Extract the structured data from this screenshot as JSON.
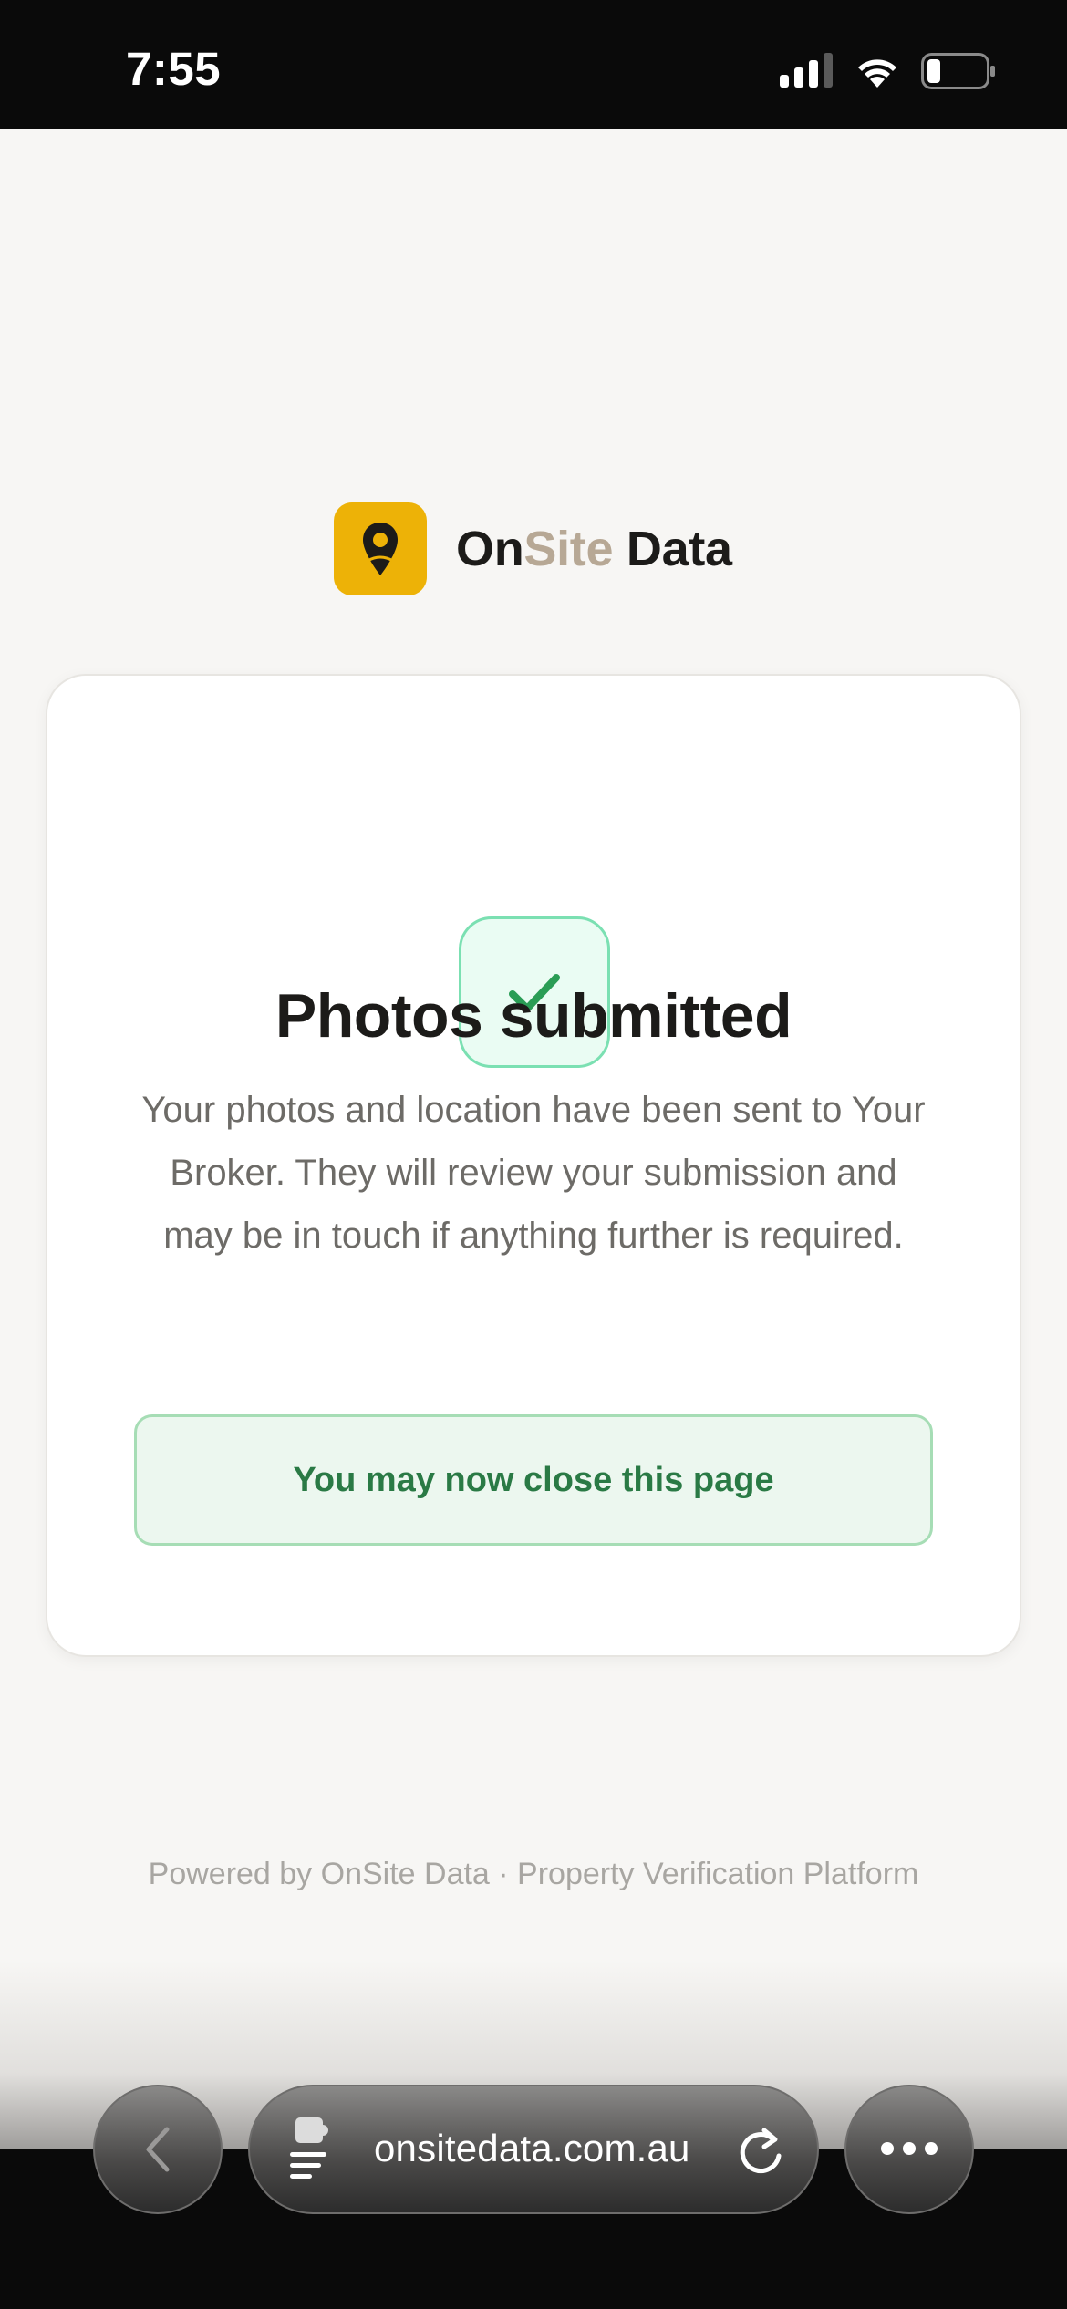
{
  "status_bar": {
    "time": "7:55",
    "icons": [
      "signal-icon",
      "wifi-icon",
      "battery-icon"
    ]
  },
  "brand": {
    "name_part1": "On",
    "name_part2": "Site",
    "name_part3": " Data",
    "logo_color": "#edb207",
    "accent_color": "#b7a895"
  },
  "card": {
    "icon": "check-icon",
    "title": "Photos submitted",
    "body": "Your photos and location have been sent to Your Broker. They will review your submission and may be in touch if anything further is required.",
    "close_notice": "You may now close this page",
    "success_color": "#2a9d55"
  },
  "footer": {
    "text": "Powered by OnSite Data · Property Verification Platform"
  },
  "browser": {
    "url": "onsitedata.com.au",
    "back_icon": "chevron-left-icon",
    "reader_icon": "reader-icon",
    "reload_icon": "reload-icon",
    "more_icon": "more-icon"
  }
}
